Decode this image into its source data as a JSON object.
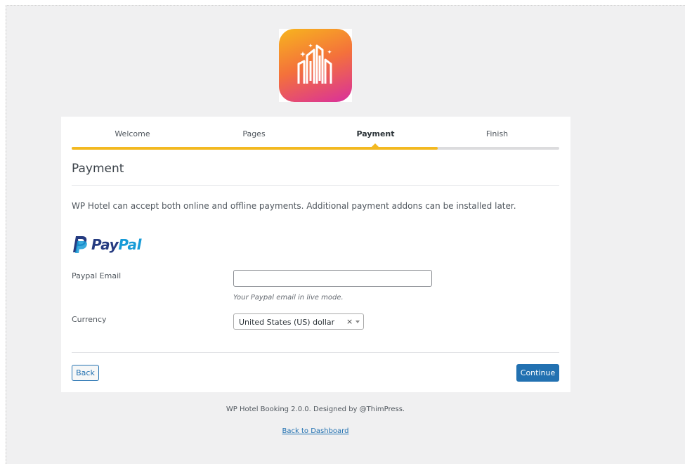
{
  "branding": {
    "logo_icon": "hotel-building-icon",
    "logo_gradient": [
      "#f7b51e",
      "#f4713b",
      "#d92f9d"
    ]
  },
  "steps": [
    {
      "label": "Welcome",
      "active": false
    },
    {
      "label": "Pages",
      "active": false
    },
    {
      "label": "Payment",
      "active": true
    },
    {
      "label": "Finish",
      "active": false
    }
  ],
  "progress": {
    "fraction": 0.75,
    "color": "#f3b921"
  },
  "payment": {
    "title": "Payment",
    "description": "WP Hotel can accept both online and offline payments. Additional payment addons can be installed later.",
    "paypal": {
      "logo_text_dark": "Pay",
      "logo_text_light": "Pal",
      "email_label": "Paypal Email",
      "email_value": "",
      "email_placeholder": "",
      "email_hint": "Your Paypal email in live mode.",
      "currency_label": "Currency",
      "currency_value": "United States (US) dollar",
      "currency_clear": "×"
    }
  },
  "buttons": {
    "back": "Back",
    "continue": "Continue",
    "primary_color": "#2271b1"
  },
  "footer": {
    "credit": "WP Hotel Booking 2.0.0. Designed by @ThimPress.",
    "dashboard_link": "Back to Dashboard"
  }
}
